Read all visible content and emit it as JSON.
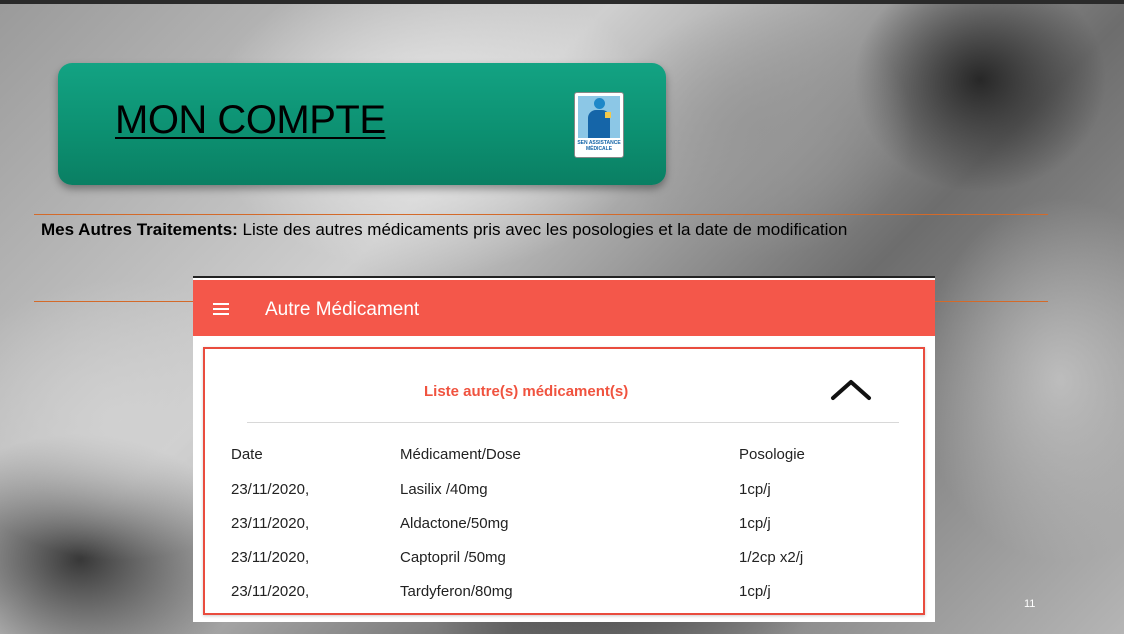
{
  "slide": {
    "title": "MON COMPTE",
    "logo_text": "SEN ASSISTANCE MÉDICALE",
    "subtitle_bold": "Mes Autres Traitements:",
    "subtitle_rest": " Liste des autres médicaments pris avec les posologies et la date de modification",
    "page_number": "11"
  },
  "app": {
    "appbar_title": "Autre Médicament",
    "card_title": "Liste autre(s) médicament(s)",
    "table": {
      "headers": [
        "Date",
        "Médicament/Dose",
        "Posologie"
      ],
      "rows": [
        [
          "23/11/2020,",
          "Lasilix /40mg",
          "1cp/j"
        ],
        [
          "23/11/2020,",
          "Aldactone/50mg",
          "1cp/j"
        ],
        [
          "23/11/2020,",
          "Captopril /50mg",
          "1/2cp x2/j"
        ],
        [
          "23/11/2020,",
          "Tardyferon/80mg",
          "1cp/j"
        ]
      ]
    }
  },
  "colors": {
    "title_box": "#0c8f70",
    "appbar": "#f4574a",
    "card_accent": "#f0533f",
    "rule": "#d36a2a"
  },
  "icons": {
    "menu": "hamburger-icon",
    "collapse": "chevron-up-icon",
    "logo": "sen-assistance-logo"
  }
}
